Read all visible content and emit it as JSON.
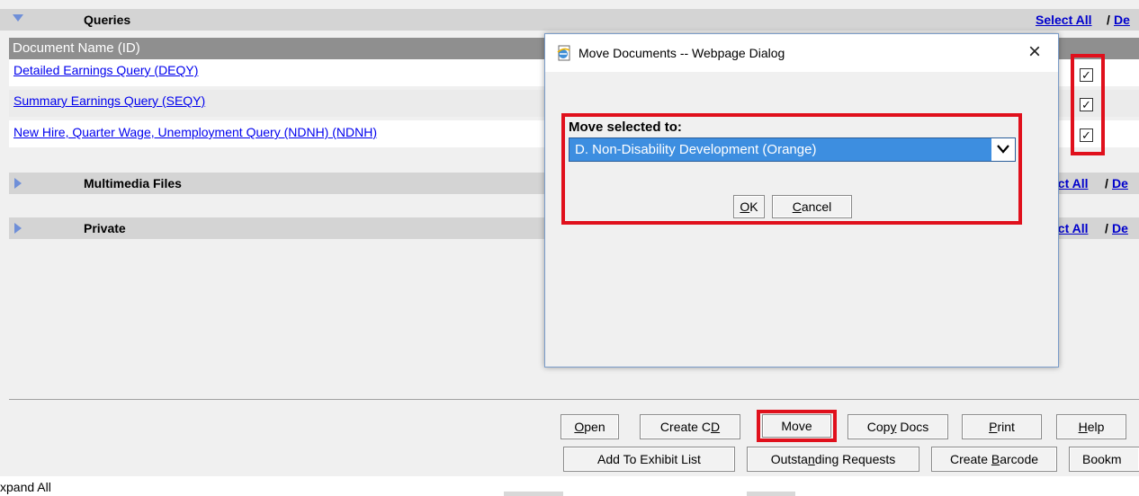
{
  "sections": {
    "queries": {
      "title": "Queries",
      "select_all": "Select All",
      "deselect_partial": "De"
    },
    "multimedia": {
      "title": "Multimedia Files",
      "select_all_partial": "ect All",
      "deselect_partial": "De"
    },
    "private": {
      "title": "Private",
      "select_all_partial": "ect All",
      "deselect_partial": "De"
    }
  },
  "slash": "/",
  "table": {
    "header": "Document Name (ID)",
    "rows": [
      {
        "name": "Detailed Earnings Query (DEQY)",
        "checked": true
      },
      {
        "name": "Summary Earnings Query (SEQY)",
        "checked": true
      },
      {
        "name": "New Hire, Quarter Wage, Unemployment Query (NDNH) (NDNH)",
        "checked": true
      }
    ]
  },
  "checkmark": "✓",
  "dialog": {
    "title": "Move Documents -- Webpage Dialog",
    "close": "×",
    "label": "Move selected to:",
    "selected_option": "D. Non-Disability Development (Orange)",
    "ok_prefix": "",
    "ok_hot": "O",
    "ok_rest": "K",
    "cancel_hot": "C",
    "cancel_rest": "ancel"
  },
  "toolbar": {
    "open_hot": "O",
    "open_rest": "pen",
    "create_cd_pre": "Create C",
    "create_cd_hot": "D",
    "move": "Move",
    "copy_pre": "Copy",
    "copy_hot": "y",
    "copy_rest": " Docs",
    "copy_base": "Cop",
    "print_hot": "P",
    "print_rest": "rint",
    "help_hot": "H",
    "help_rest": "elp",
    "add_exhibit": "Add To Exhibit List",
    "outstanding_pre": "Outsta",
    "outstanding_hot": "n",
    "outstanding_rest": "ding Requests",
    "barcode_pre": "Create ",
    "barcode_hot": "B",
    "barcode_rest": "arcode",
    "bookmark_partial": "Bookm"
  },
  "footer": {
    "expand_all_partial": "xpand All"
  }
}
